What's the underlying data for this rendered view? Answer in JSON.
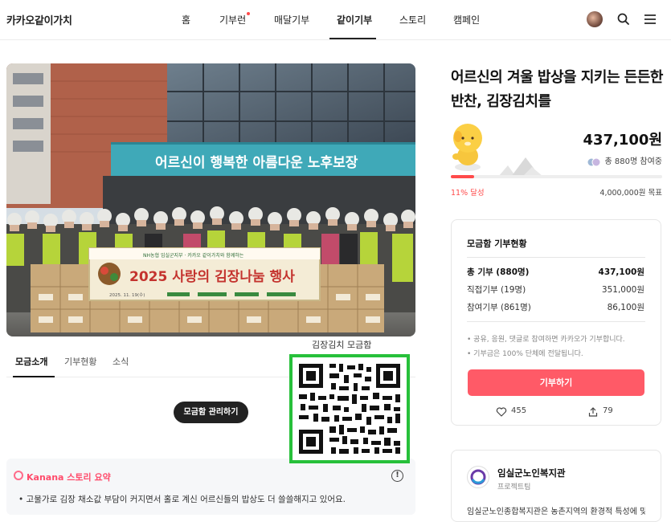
{
  "header": {
    "logo_prefix": "카카오",
    "logo_suffix": "같이가치",
    "nav": [
      {
        "label": "홈"
      },
      {
        "label": "기부런"
      },
      {
        "label": "매달기부"
      },
      {
        "label": "같이기부"
      },
      {
        "label": "스토리"
      },
      {
        "label": "캠페인"
      }
    ],
    "active_nav": "같이기부",
    "icons": [
      "avatar",
      "search-icon",
      "menu-icon"
    ]
  },
  "hero": {
    "building_sign": "어르신이 행복한 아름다운 노후보장",
    "banner_title": "2025 사랑의 김장나눔 행사",
    "banner_top": "NH농협 임실군지부 · 카카오 같이가치와 함께하는",
    "banner_date": "2025. 11. 19(수)"
  },
  "tabs": {
    "items": [
      {
        "label": "모금소개"
      },
      {
        "label": "기부현황"
      },
      {
        "label": "소식"
      }
    ],
    "active": "모금소개"
  },
  "manage_button": "모금함 관리하기",
  "summary": {
    "title": "Kanana 스토리 요약",
    "text": "• 고물가로 김장 채소값 부담이 커지면서 홀로 계신 어르신들의 밥상도 더 쓸쓸해지고 있어요."
  },
  "qr": {
    "label": "김장김치 모금함",
    "border_color": "#27c03a"
  },
  "campaign": {
    "title": "어르신의 겨울 밥상을 지키는 든든한 반찬, 김장김치를",
    "amount": "437,100원",
    "participants": "총 880명 참여중",
    "progress_percent": 11,
    "progress_label": "11% 달성",
    "goal": "4,000,000원 목표",
    "accent": "#ff4b4b"
  },
  "status_card": {
    "title": "모금함 기부현황",
    "rows": [
      {
        "label": "총 기부 (880명)",
        "value": "437,100원"
      },
      {
        "label": "직접기부 (19명)",
        "value": "351,000원"
      },
      {
        "label": "참여기부 (861명)",
        "value": "86,100원"
      }
    ],
    "notes": [
      "• 공유, 응원, 댓글로 참여하면 카카오가 기부합니다.",
      "• 기부금은 100% 단체에 전달됩니다."
    ],
    "donate_button": "기부하기",
    "likes": "455",
    "shares": "79"
  },
  "organization": {
    "name": "임실군노인복지관",
    "type": "프로젝트팀",
    "desc": "임실군노인종합복지관은 농촌지역의 환경적 특성에 맞"
  }
}
